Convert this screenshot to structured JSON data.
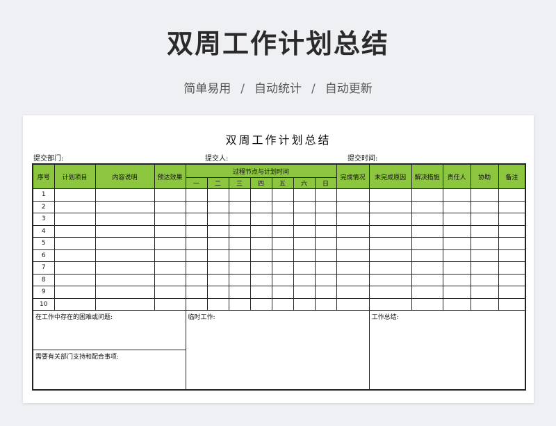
{
  "banner": {
    "title": "双周工作计划总结",
    "subtitle_parts": [
      "简单易用",
      "自动统计",
      "自动更新"
    ],
    "separator": "/"
  },
  "document": {
    "title": "双周工作计划总结",
    "meta": {
      "department_label": "提交部门:",
      "submitter_label": "提交人:",
      "submit_time_label": "提交时间:"
    },
    "table": {
      "header_color": "#8cc63f",
      "columns": {
        "seq": "序号",
        "plan_item": "计划项目",
        "content": "内容说明",
        "expected": "预达效果",
        "progress_group": "过程节点与计划时间",
        "days": [
          "一",
          "二",
          "三",
          "四",
          "五",
          "六",
          "日"
        ],
        "status": "完成情况",
        "unfinished_reason": "未完成原因",
        "solution": "解决措施",
        "owner": "责任人",
        "assist": "协助",
        "note": "备注"
      },
      "rows": [
        "1",
        "2",
        "3",
        "4",
        "5",
        "6",
        "7",
        "8",
        "9",
        "10"
      ],
      "footer": {
        "problems_label": "在工作中存在的困难或问题:",
        "temp_work_label": "临时工作:",
        "summary_label": "工作总结:",
        "support_label": "需要有关部门支持和配合事项:"
      }
    }
  }
}
